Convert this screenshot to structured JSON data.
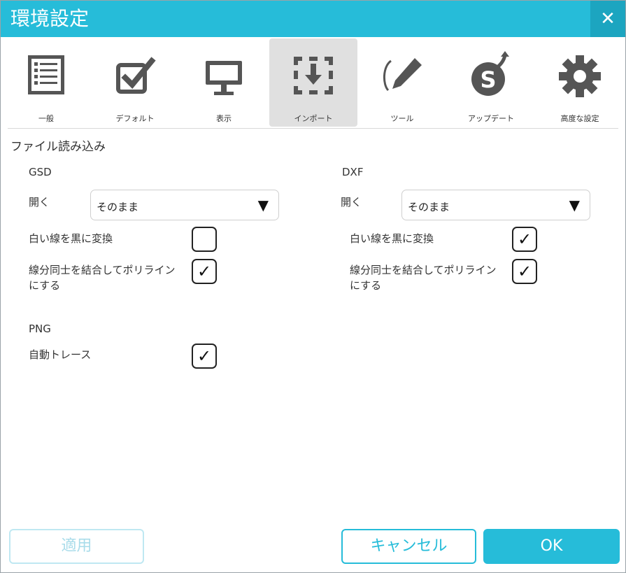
{
  "window": {
    "title": "環境設定",
    "close_label": "✕"
  },
  "toolbar": {
    "items": [
      {
        "label": "一般",
        "icon": "list-document-icon"
      },
      {
        "label": "デフォルト",
        "icon": "checkbox-icon"
      },
      {
        "label": "表示",
        "icon": "monitor-icon"
      },
      {
        "label": "インポート",
        "icon": "import-icon",
        "active": true
      },
      {
        "label": "ツール",
        "icon": "pen-tool-icon"
      },
      {
        "label": "アップデート",
        "icon": "update-icon"
      },
      {
        "label": "高度な設定",
        "icon": "gear-icon"
      }
    ]
  },
  "section": {
    "title": "ファイル読み込み"
  },
  "gsd": {
    "heading": "GSD",
    "open_label": "開く",
    "open_value": "そのまま",
    "white_label": "白い線を黒に変換",
    "white_checked": false,
    "join_label_line1": "線分同士を結合してポリライン",
    "join_label_line2": "にする",
    "join_checked": true
  },
  "dxf": {
    "heading": "DXF",
    "open_label": "開く",
    "open_value": "そのまま",
    "white_label": "白い線を黒に変換",
    "white_checked": true,
    "join_label_line1": "線分同士を結合してポリライン",
    "join_label_line2": "にする",
    "join_checked": true
  },
  "png": {
    "heading": "PNG",
    "trace_label": "自動トレース",
    "trace_checked": true
  },
  "buttons": {
    "apply": "適用",
    "cancel": "キャンセル",
    "ok": "OK"
  },
  "glyphs": {
    "check": "✓",
    "dropdown": "▼"
  }
}
